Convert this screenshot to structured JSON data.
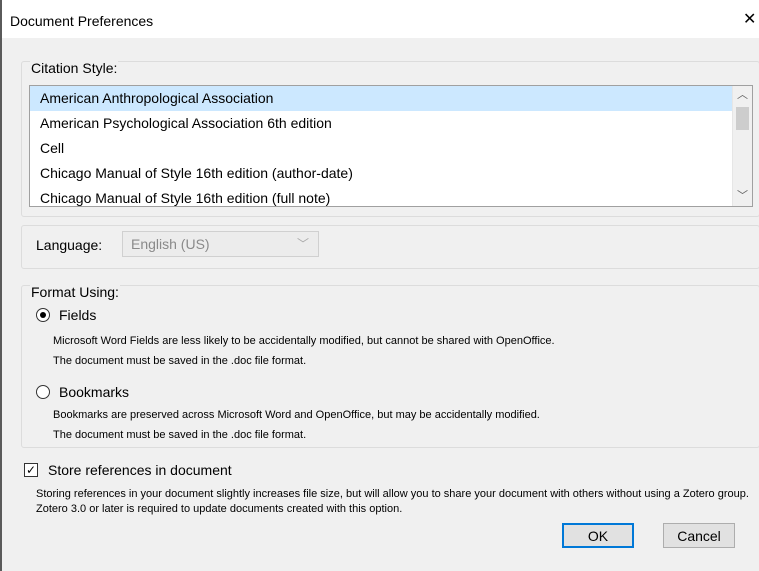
{
  "window": {
    "title": "Document Preferences",
    "close_glyph": "✕"
  },
  "citation": {
    "legend": "Citation Style:",
    "items": [
      "American Anthropological Association",
      "American Psychological Association 6th edition",
      "Cell",
      "Chicago Manual of Style 16th edition (author-date)",
      "Chicago Manual of Style 16th edition (full note)"
    ],
    "selected_index": 0,
    "scroll_up_glyph": "︿",
    "scroll_down_glyph": "﹀"
  },
  "language": {
    "label": "Language:",
    "value": "English (US)",
    "chevron": "﹀"
  },
  "format": {
    "legend": "Format Using:",
    "fields": {
      "label": "Fields",
      "checked": true,
      "desc1": "Microsoft Word Fields are less likely to be accidentally modified, but cannot be shared with OpenOffice.",
      "desc2": "The document must be saved in the .doc file format."
    },
    "bookmarks": {
      "label": "Bookmarks",
      "checked": false,
      "desc1": "Bookmarks are preserved across Microsoft Word and OpenOffice, but may be accidentally modified.",
      "desc2": "The document must be saved in the .doc file format."
    }
  },
  "store": {
    "label": "Store references in document",
    "checked": true,
    "check_glyph": "✓",
    "desc": "Storing references in your document slightly increases file size, but will allow you to share your document with others without using a Zotero group. Zotero 3.0 or later is required to update documents created with this option."
  },
  "buttons": {
    "ok": "OK",
    "cancel": "Cancel"
  },
  "colors": {
    "selection": "#cce8ff",
    "default_button_border": "#0078d7",
    "dialog_bg": "#f0f0f0"
  }
}
